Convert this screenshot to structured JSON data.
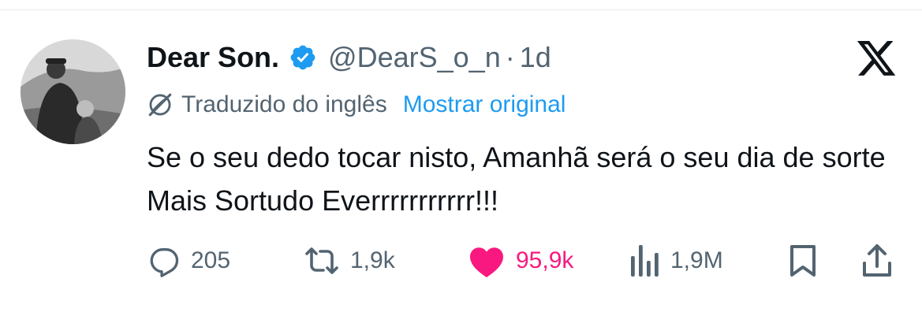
{
  "tweet": {
    "author_name": "Dear Son.",
    "handle": "@DearS_o_n",
    "separator": "·",
    "time": "1d",
    "translation_note": "Traduzido do inglês",
    "show_original": "Mostrar original",
    "text": "Se o seu dedo tocar nisto, Amanhã será o seu dia de sorte Mais Sortudo Everrrrrrrrrrr!!!"
  },
  "actions": {
    "replies": "205",
    "reposts": "1,9k",
    "likes": "95,9k",
    "views": "1,9M"
  },
  "colors": {
    "verified": "#1d9bf0",
    "link": "#1d9bf0",
    "like": "#f91880",
    "muted": "#536471",
    "text": "#0f1419"
  },
  "icons": {
    "verified": "verified-badge-icon",
    "logo": "x-logo-icon",
    "translate": "translate-off-icon",
    "reply": "reply-icon",
    "repost": "repost-icon",
    "like": "heart-icon",
    "views": "views-icon",
    "bookmark": "bookmark-icon",
    "share": "share-icon"
  }
}
